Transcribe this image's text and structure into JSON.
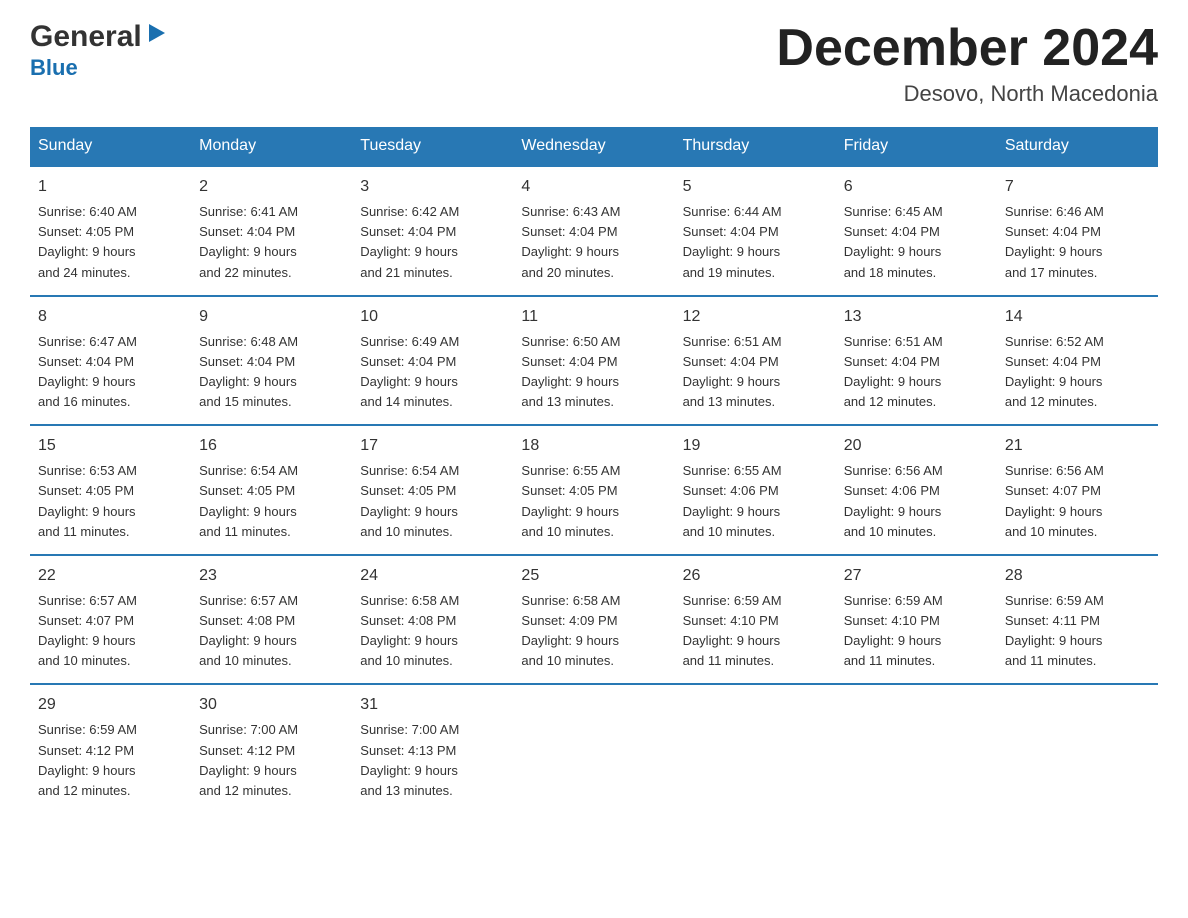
{
  "logo": {
    "general": "General",
    "blue": "Blue",
    "arrow": "▶"
  },
  "title": "December 2024",
  "location": "Desovo, North Macedonia",
  "weekdays": [
    "Sunday",
    "Monday",
    "Tuesday",
    "Wednesday",
    "Thursday",
    "Friday",
    "Saturday"
  ],
  "weeks": [
    [
      {
        "day": "1",
        "sunrise": "6:40 AM",
        "sunset": "4:05 PM",
        "daylight": "9 hours and 24 minutes."
      },
      {
        "day": "2",
        "sunrise": "6:41 AM",
        "sunset": "4:04 PM",
        "daylight": "9 hours and 22 minutes."
      },
      {
        "day": "3",
        "sunrise": "6:42 AM",
        "sunset": "4:04 PM",
        "daylight": "9 hours and 21 minutes."
      },
      {
        "day": "4",
        "sunrise": "6:43 AM",
        "sunset": "4:04 PM",
        "daylight": "9 hours and 20 minutes."
      },
      {
        "day": "5",
        "sunrise": "6:44 AM",
        "sunset": "4:04 PM",
        "daylight": "9 hours and 19 minutes."
      },
      {
        "day": "6",
        "sunrise": "6:45 AM",
        "sunset": "4:04 PM",
        "daylight": "9 hours and 18 minutes."
      },
      {
        "day": "7",
        "sunrise": "6:46 AM",
        "sunset": "4:04 PM",
        "daylight": "9 hours and 17 minutes."
      }
    ],
    [
      {
        "day": "8",
        "sunrise": "6:47 AM",
        "sunset": "4:04 PM",
        "daylight": "9 hours and 16 minutes."
      },
      {
        "day": "9",
        "sunrise": "6:48 AM",
        "sunset": "4:04 PM",
        "daylight": "9 hours and 15 minutes."
      },
      {
        "day": "10",
        "sunrise": "6:49 AM",
        "sunset": "4:04 PM",
        "daylight": "9 hours and 14 minutes."
      },
      {
        "day": "11",
        "sunrise": "6:50 AM",
        "sunset": "4:04 PM",
        "daylight": "9 hours and 13 minutes."
      },
      {
        "day": "12",
        "sunrise": "6:51 AM",
        "sunset": "4:04 PM",
        "daylight": "9 hours and 13 minutes."
      },
      {
        "day": "13",
        "sunrise": "6:51 AM",
        "sunset": "4:04 PM",
        "daylight": "9 hours and 12 minutes."
      },
      {
        "day": "14",
        "sunrise": "6:52 AM",
        "sunset": "4:04 PM",
        "daylight": "9 hours and 12 minutes."
      }
    ],
    [
      {
        "day": "15",
        "sunrise": "6:53 AM",
        "sunset": "4:05 PM",
        "daylight": "9 hours and 11 minutes."
      },
      {
        "day": "16",
        "sunrise": "6:54 AM",
        "sunset": "4:05 PM",
        "daylight": "9 hours and 11 minutes."
      },
      {
        "day": "17",
        "sunrise": "6:54 AM",
        "sunset": "4:05 PM",
        "daylight": "9 hours and 10 minutes."
      },
      {
        "day": "18",
        "sunrise": "6:55 AM",
        "sunset": "4:05 PM",
        "daylight": "9 hours and 10 minutes."
      },
      {
        "day": "19",
        "sunrise": "6:55 AM",
        "sunset": "4:06 PM",
        "daylight": "9 hours and 10 minutes."
      },
      {
        "day": "20",
        "sunrise": "6:56 AM",
        "sunset": "4:06 PM",
        "daylight": "9 hours and 10 minutes."
      },
      {
        "day": "21",
        "sunrise": "6:56 AM",
        "sunset": "4:07 PM",
        "daylight": "9 hours and 10 minutes."
      }
    ],
    [
      {
        "day": "22",
        "sunrise": "6:57 AM",
        "sunset": "4:07 PM",
        "daylight": "9 hours and 10 minutes."
      },
      {
        "day": "23",
        "sunrise": "6:57 AM",
        "sunset": "4:08 PM",
        "daylight": "9 hours and 10 minutes."
      },
      {
        "day": "24",
        "sunrise": "6:58 AM",
        "sunset": "4:08 PM",
        "daylight": "9 hours and 10 minutes."
      },
      {
        "day": "25",
        "sunrise": "6:58 AM",
        "sunset": "4:09 PM",
        "daylight": "9 hours and 10 minutes."
      },
      {
        "day": "26",
        "sunrise": "6:59 AM",
        "sunset": "4:10 PM",
        "daylight": "9 hours and 11 minutes."
      },
      {
        "day": "27",
        "sunrise": "6:59 AM",
        "sunset": "4:10 PM",
        "daylight": "9 hours and 11 minutes."
      },
      {
        "day": "28",
        "sunrise": "6:59 AM",
        "sunset": "4:11 PM",
        "daylight": "9 hours and 11 minutes."
      }
    ],
    [
      {
        "day": "29",
        "sunrise": "6:59 AM",
        "sunset": "4:12 PM",
        "daylight": "9 hours and 12 minutes."
      },
      {
        "day": "30",
        "sunrise": "7:00 AM",
        "sunset": "4:12 PM",
        "daylight": "9 hours and 12 minutes."
      },
      {
        "day": "31",
        "sunrise": "7:00 AM",
        "sunset": "4:13 PM",
        "daylight": "9 hours and 13 minutes."
      },
      null,
      null,
      null,
      null
    ]
  ],
  "labels": {
    "sunrise": "Sunrise:",
    "sunset": "Sunset:",
    "daylight": "Daylight:"
  }
}
